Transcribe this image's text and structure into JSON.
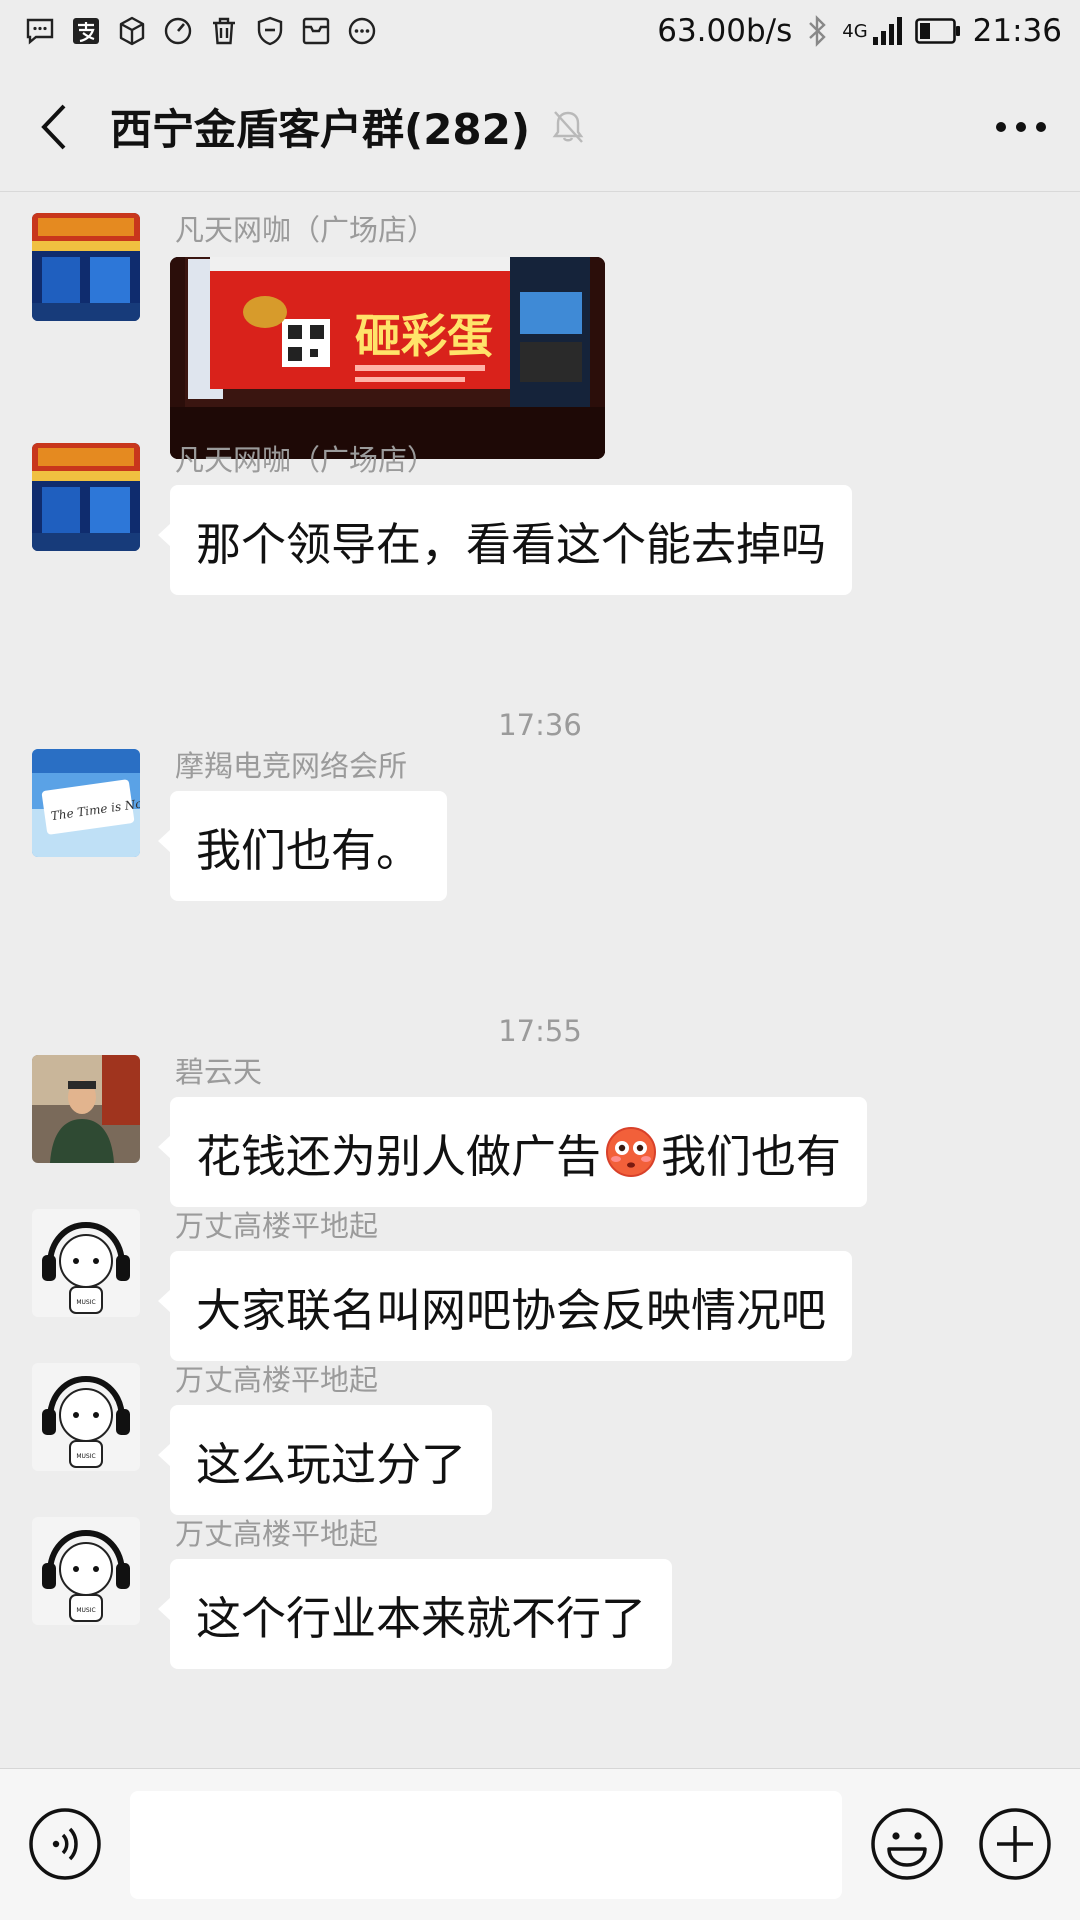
{
  "status_bar": {
    "network_speed": "63.00b/s",
    "network_type": "4G",
    "time": "21:36",
    "icons": [
      "message-icon",
      "alipay-icon",
      "box-icon",
      "speedometer-icon",
      "trash-icon",
      "shield-icon",
      "inbox-icon",
      "more-circle-icon"
    ]
  },
  "header": {
    "title": "西宁金盾客户群(282)",
    "muted": true
  },
  "messages": [
    {
      "type": "image",
      "sender": "凡天网咖（广场店）",
      "avatar": "netcafe-storefront",
      "image_caption": "砸彩蛋"
    },
    {
      "type": "text",
      "sender": "凡天网咖（广场店）",
      "avatar": "netcafe-storefront",
      "text": "那个领导在，看看这个能去掉吗"
    },
    {
      "type": "time",
      "text": "17:36"
    },
    {
      "type": "text",
      "sender": "摩羯电竞网络会所",
      "avatar": "the-time-is-now",
      "avatar_text": "The Time is Now",
      "text": "我们也有。"
    },
    {
      "type": "time",
      "text": "17:55"
    },
    {
      "type": "text",
      "sender": "碧云天",
      "avatar": "man-photo",
      "text_before": "花钱还为别人做广告",
      "text_after": "我们也有",
      "emoji": "flushed-face"
    },
    {
      "type": "text",
      "sender": "万丈高楼平地起",
      "avatar": "headphone-character",
      "avatar_text": "MUSIC",
      "text": "大家联名叫网吧协会反映情况吧"
    },
    {
      "type": "text",
      "sender": "万丈高楼平地起",
      "avatar": "headphone-character",
      "avatar_text": "MUSIC",
      "text": "这么玩过分了"
    },
    {
      "type": "text",
      "sender": "万丈高楼平地起",
      "avatar": "headphone-character",
      "avatar_text": "MUSIC",
      "text": "这个行业本来就不行了"
    }
  ],
  "input_bar": {
    "value": ""
  },
  "colors": {
    "background": "#ededed",
    "bubble": "#ffffff",
    "sender_name": "#9b9b9b",
    "text": "#111111"
  }
}
